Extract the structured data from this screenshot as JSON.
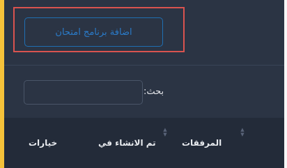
{
  "toolbar": {
    "add_exam_program_label": "اضافة برنامج امتحان"
  },
  "search": {
    "label": "بحث:",
    "value": "",
    "placeholder": ""
  },
  "table": {
    "columns": [
      {
        "label": "المرفقات",
        "sortable": true
      },
      {
        "label": "تم الانشاء في",
        "sortable": true
      },
      {
        "label": "خيارات",
        "sortable": false
      }
    ]
  },
  "colors": {
    "panel_background": "#2b3444",
    "table_header_background": "#232b39",
    "button_accent": "#2a7bc9",
    "highlight_border": "#d9534f",
    "left_accent": "#f5c23a"
  },
  "icons": {
    "sort": "sort-icon"
  }
}
